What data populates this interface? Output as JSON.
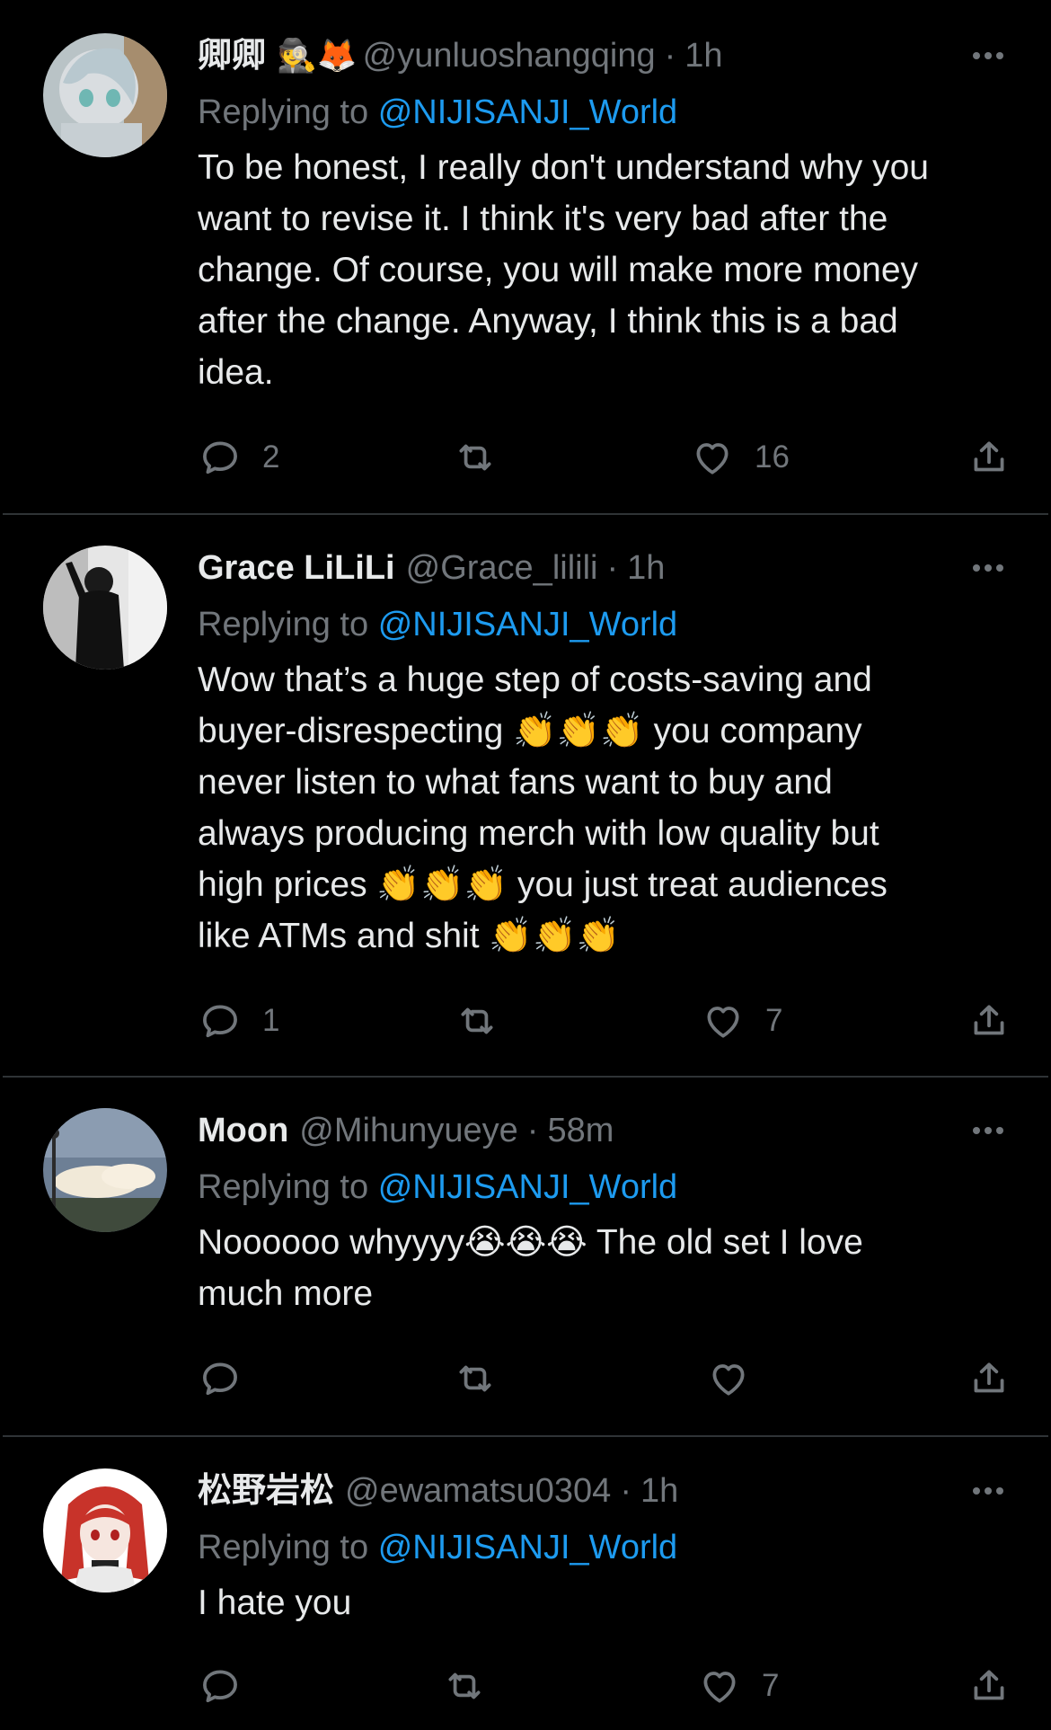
{
  "replying_label": "Replying to",
  "mention": "@NIJISANJI_World",
  "icons": {
    "reply": "reply-bubble-icon",
    "retweet": "retweet-icon",
    "like": "heart-icon",
    "share": "share-icon",
    "more": "more-dots-icon"
  },
  "colors": {
    "background": "#000000",
    "text": "#e7e9ea",
    "muted": "#71767b",
    "link": "#1d9bf0",
    "divider": "#2f3336"
  },
  "tweets": [
    {
      "name": "卿卿",
      "name_emoji": "🕵️🦊",
      "handle": "@yunluoshangqing",
      "time": "1h",
      "text_lines": [
        "To be honest, I really don't understand why you",
        "want to revise it. I think it's very bad after the",
        "change. Of course, you will make more money",
        "after the change. Anyway, I think this is a bad",
        "idea."
      ],
      "replies": "2",
      "retweets": "",
      "likes": "16"
    },
    {
      "name": "Grace LiLiLi",
      "name_emoji": "",
      "handle": "@Grace_lilili",
      "time": "1h",
      "text_lines": [
        "Wow that’s a huge step of costs-saving and",
        "buyer-disrespecting 👏👏👏 you company",
        "never listen to what fans want to buy and",
        "always producing merch with low quality but",
        "high prices 👏👏👏 you just treat audiences",
        "like ATMs and shit 👏👏👏"
      ],
      "replies": "1",
      "retweets": "",
      "likes": "7"
    },
    {
      "name": "Moon",
      "name_emoji": "",
      "handle": "@Mihunyueye",
      "time": "58m",
      "text_lines": [
        "Noooooo whyyyy😭😭😭 The old set I love",
        "much more"
      ],
      "replies": "",
      "retweets": "",
      "likes": ""
    },
    {
      "name": "松野岩松",
      "name_emoji": "",
      "handle": "@ewamatsu0304",
      "time": "1h",
      "text_lines": [
        "I hate you"
      ],
      "replies": "",
      "retweets": "",
      "likes": "7"
    }
  ]
}
